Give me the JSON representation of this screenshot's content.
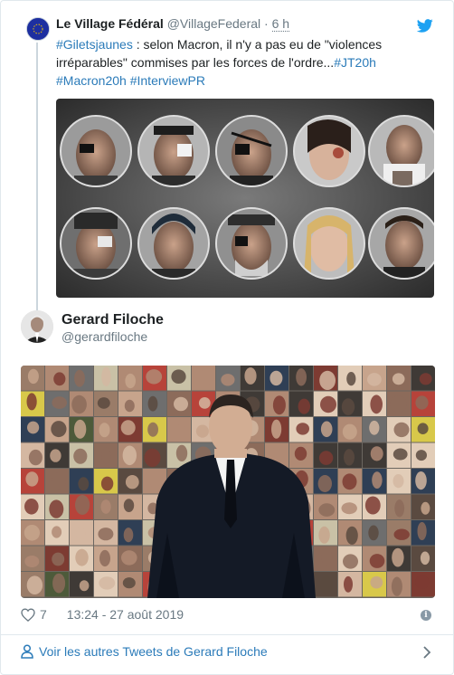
{
  "quoted": {
    "name": "Le Village Fédéral",
    "handle": "@VillageFederal",
    "separator": " · ",
    "time": "6 h",
    "text_parts": [
      {
        "t": "#Giletsjaunes",
        "tag": true
      },
      {
        "t": " : selon Macron, il n'y a pas eu de \"violences irréparables\" commises par les forces de l'ordre...",
        "tag": false
      },
      {
        "t": "#JT20h",
        "tag": true
      },
      {
        "t": " ",
        "tag": false
      },
      {
        "t": "#Macron20h",
        "tag": true
      },
      {
        "t": " ",
        "tag": false
      },
      {
        "t": "#InterviewPR",
        "tag": true
      }
    ]
  },
  "author": {
    "name": "Gerard Filoche",
    "handle": "@gerardfiloche"
  },
  "footer": {
    "likes": "7",
    "timestamp": "13:24 - 27 août 2019",
    "info_glyph": "i",
    "more_link": "Voir les autres Tweets de Gerard Filoche"
  },
  "colors": {
    "link": "#2b7bb9",
    "muted": "#697882",
    "twitter_blue": "#1da1f2"
  },
  "icons": [
    "twitter-bird-icon",
    "heart-icon",
    "info-icon",
    "user-icon",
    "chevron-right-icon"
  ]
}
